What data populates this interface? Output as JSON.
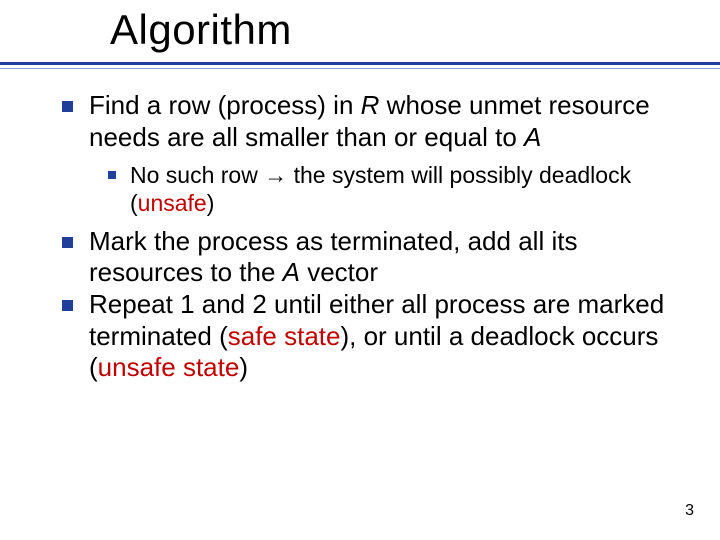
{
  "title": "Algorithm",
  "bullets": {
    "b1_pre": "Find a row (process) in ",
    "b1_R": "R",
    "b1_mid": " whose unmet resource needs are all smaller than or equal to ",
    "b1_A": "A",
    "b1a_pre": "No such row ",
    "b1a_arrow": "→",
    "b1a_mid": " the system will possibly deadlock (",
    "b1a_unsafe": "unsafe",
    "b1a_post": ")",
    "b2_pre": "Mark the process as terminated, add all its resources to the ",
    "b2_A": "A",
    "b2_post": " vector",
    "b3_pre": "Repeat 1 and 2 until either all process are marked terminated (",
    "b3_safe": "safe state",
    "b3_mid": "), or until a deadlock occurs (",
    "b3_unsafe": "unsafe state",
    "b3_post": ")"
  },
  "page_number": "3"
}
